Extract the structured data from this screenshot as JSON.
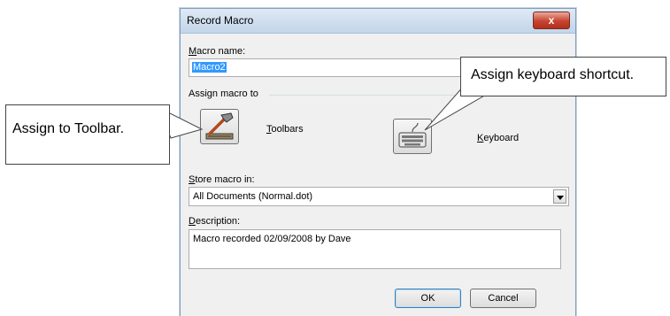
{
  "dialog": {
    "title": "Record Macro",
    "close_label": "x"
  },
  "macro_name": {
    "label_accel": "M",
    "label_rest": "acro name:",
    "value": "Macro2"
  },
  "assign": {
    "group_label": "Assign macro to",
    "toolbars_accel": "T",
    "toolbars_rest": "oolbars",
    "keyboard_accel": "K",
    "keyboard_rest": "eyboard"
  },
  "store": {
    "label_accel": "S",
    "label_rest": "tore macro in:",
    "value": "All Documents (Normal.dot)"
  },
  "description": {
    "label_accel": "D",
    "label_rest": "escription:",
    "value": "Macro recorded 02/09/2008 by Dave"
  },
  "buttons": {
    "ok": "OK",
    "cancel": "Cancel"
  },
  "callouts": {
    "toolbar": "Assign to Toolbar.",
    "keyboard": "Assign keyboard shortcut."
  }
}
